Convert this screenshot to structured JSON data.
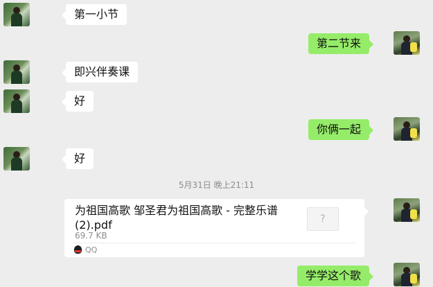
{
  "messages": [
    {
      "side": "left",
      "text": "第一小节"
    },
    {
      "side": "right",
      "text": "第二节来"
    },
    {
      "side": "left",
      "text": "即兴伴奏课"
    },
    {
      "side": "left",
      "text": "好"
    },
    {
      "side": "right",
      "text": "你俩一起"
    },
    {
      "side": "left",
      "text": "好"
    }
  ],
  "timestamp": "5月31日 晚上21:11",
  "file": {
    "name": "为祖国高歌 邹圣君为祖国高歌 - 完整乐谱(2).pdf",
    "size": "69.7 KB",
    "icon_glyph": "?",
    "source": "QQ"
  },
  "last_message": {
    "side": "right",
    "text": "学学这个歌"
  }
}
